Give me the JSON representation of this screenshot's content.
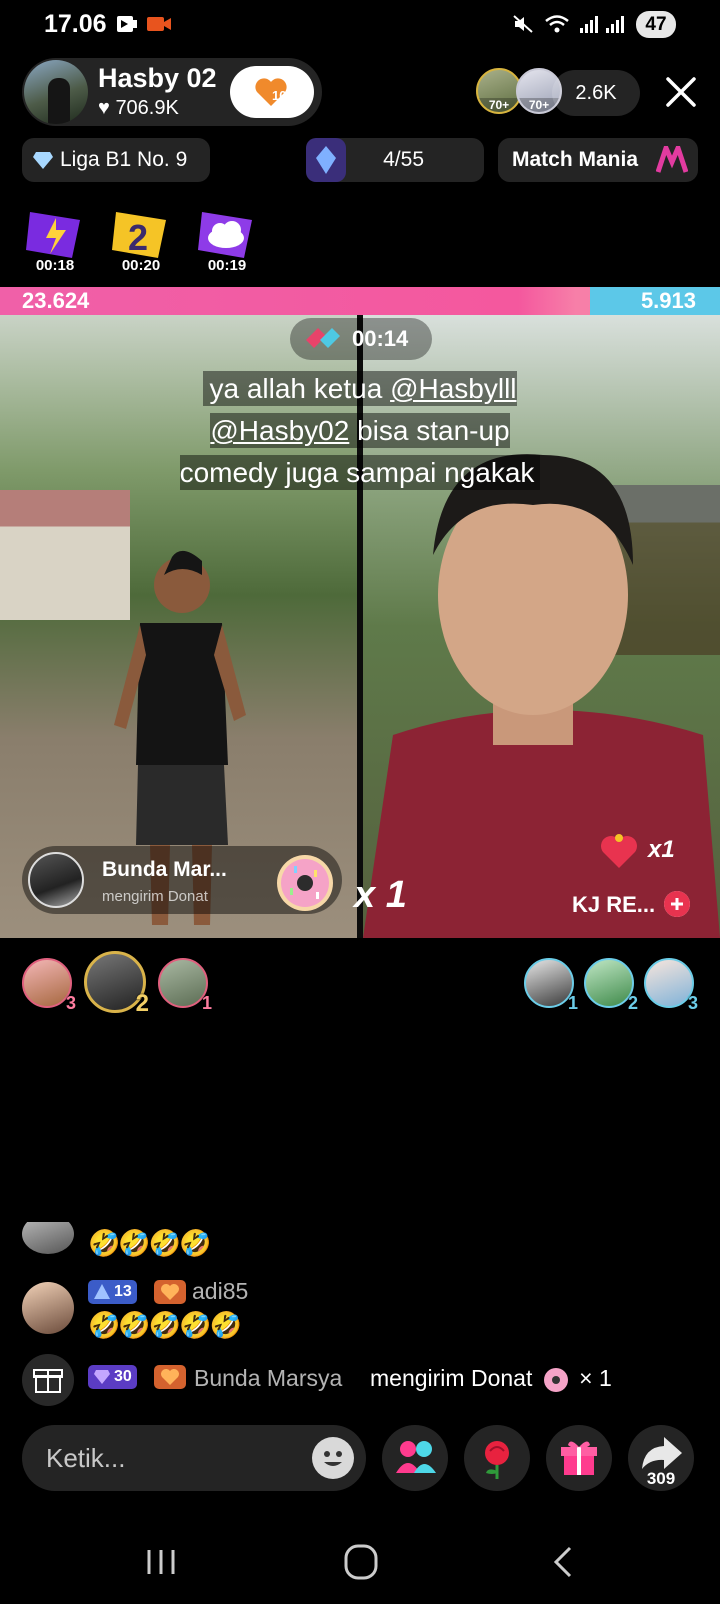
{
  "status_bar": {
    "time": "17.06",
    "battery": "47"
  },
  "host": {
    "name": "Hasby 02",
    "likes": "706.9K",
    "follow_level": "10"
  },
  "viewers": {
    "badge1": "70+",
    "badge2": "70+",
    "count": "2.6K"
  },
  "chips": {
    "league": "Liga B1 No. 9",
    "progress": "4/55",
    "match": "Match Mania"
  },
  "timers": [
    "00:18",
    "00:20",
    "00:19"
  ],
  "score": {
    "left": "23.624",
    "right": "5.913",
    "left_fraction": 0.8
  },
  "battle": {
    "round_timer": "00:14",
    "comment_prefix": "ya allah ketua ",
    "mention1": "@Hasbylll",
    "mention2": "@Hasby02",
    "comment_suffix": " bisa stan-up comedy juga sampai ngakak"
  },
  "gift_notification": {
    "sender": "Bunda Mar...",
    "action": "mengirim Donat",
    "count": "x 1"
  },
  "opponent": {
    "gift_count": "x1",
    "name": "KJ RE..."
  },
  "contributors_left": [
    {
      "rank": "3"
    },
    {
      "rank": "2"
    },
    {
      "rank": "1"
    }
  ],
  "contributors_right": [
    {
      "rank": "1"
    },
    {
      "rank": "2"
    },
    {
      "rank": "3"
    }
  ],
  "chat": [
    {
      "emojis": "🤣🤣🤣🤣"
    },
    {
      "level": "13",
      "user": "adi85",
      "emojis": "🤣🤣🤣🤣🤣"
    },
    {
      "level": "30",
      "user": "Bunda Marsya",
      "message": "mengirim Donat",
      "count": "× 1"
    }
  ],
  "input": {
    "placeholder": "Ketik..."
  },
  "share": {
    "count": "309"
  },
  "colors": {
    "score_pink": "#f4589e",
    "score_blue": "#5cc8e8",
    "accent_gold": "#d9b34a"
  }
}
